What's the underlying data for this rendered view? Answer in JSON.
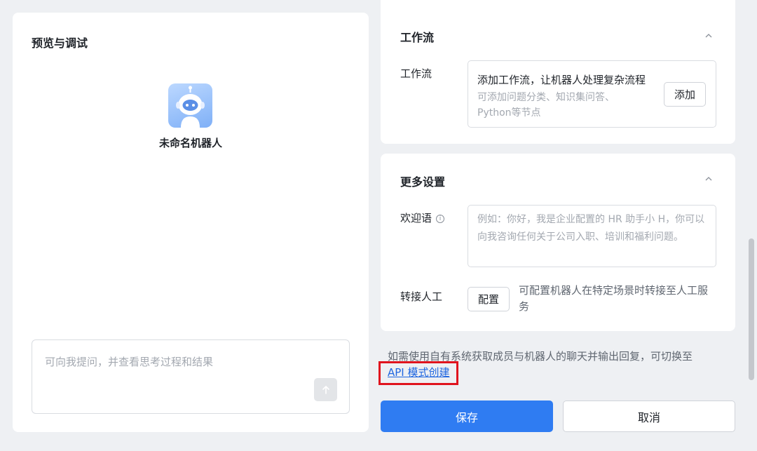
{
  "preview": {
    "title": "预览与调试",
    "bot_name": "未命名机器人",
    "chat_placeholder": "可向我提问，并查看思考过程和结果"
  },
  "workflow_section": {
    "title": "工作流",
    "field_label": "工作流",
    "box_title": "添加工作流，让机器人处理复杂流程",
    "box_desc": "可添加问题分类、知识集问答、Python等节点",
    "add_button": "添加"
  },
  "more_settings": {
    "title": "更多设置",
    "welcome_label": "欢迎语",
    "welcome_placeholder": "例如：你好，我是企业配置的 HR 助手小 H，你可以向我咨询任何关于公司入职、培训和福利问题。",
    "handoff_label": "转接人工",
    "configure_button": "配置",
    "handoff_desc": "可配置机器人在特定场景时转接至人工服务"
  },
  "footer": {
    "note": "如需使用自有系统获取成员与机器人的聊天并输出回复，可切换至",
    "api_link": "API 模式创建",
    "save_button": "保存",
    "cancel_button": "取消"
  },
  "colors": {
    "primary": "#2f7cf2",
    "link": "#1f66e0",
    "highlight": "#e0141e"
  }
}
